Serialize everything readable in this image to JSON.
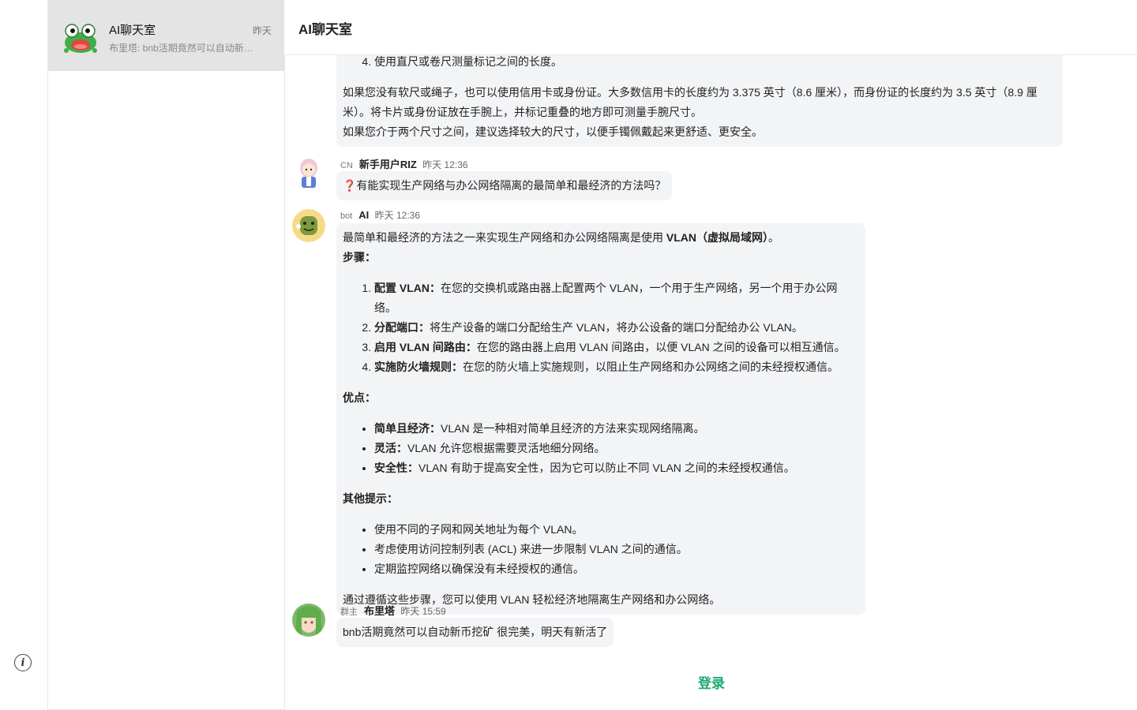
{
  "sidebar": {
    "conversation": {
      "name": "AI聊天室",
      "time": "昨天",
      "preview": "布里塔: bnb活期竟然可以自动新币挖矿 很完美，明天有新活了"
    }
  },
  "header": {
    "title": "AI聊天室"
  },
  "messages": {
    "m1": {
      "step4": "使用直尺或卷尺测量标记之间的长度。",
      "para1": "如果您没有软尺或绳子，也可以使用信用卡或身份证。大多数信用卡的长度约为 3.375 英寸（8.6 厘米），而身份证的长度约为 3.5 英寸（8.9 厘米）。将卡片或身份证放在手腕上，并标记重叠的地方即可测量手腕尺寸。",
      "para2": "如果您介于两个尺寸之间，建议选择较大的尺寸，以便手镯佩戴起来更舒适、更安全。"
    },
    "m2": {
      "role": "CN",
      "name": "新手用户RIZ",
      "time": "昨天 12:36",
      "text": "❓有能实现生产网络与办公网络隔离的最简单和最经济的方法吗？"
    },
    "m3": {
      "role": "bot",
      "name": "AI",
      "time": "昨天 12:36",
      "intro": "最简单和最经济的方法之一来实现生产网络和办公网络隔离是使用 ",
      "intro_bold": "VLAN（虚拟局域网）",
      "intro_end": "。",
      "steps_heading": "步骤：",
      "steps": [
        {
          "b": "配置 VLAN：",
          "t": "在您的交换机或路由器上配置两个 VLAN，一个用于生产网络，另一个用于办公网络。"
        },
        {
          "b": "分配端口：",
          "t": "将生产设备的端口分配给生产 VLAN，将办公设备的端口分配给办公 VLAN。"
        },
        {
          "b": "启用 VLAN 间路由：",
          "t": "在您的路由器上启用 VLAN 间路由，以便 VLAN 之间的设备可以相互通信。"
        },
        {
          "b": "实施防火墙规则：",
          "t": "在您的防火墙上实施规则，以阻止生产网络和办公网络之间的未经授权通信。"
        }
      ],
      "pros_heading": "优点：",
      "pros": [
        {
          "b": "简单且经济：",
          "t": "VLAN 是一种相对简单且经济的方法来实现网络隔离。"
        },
        {
          "b": "灵活：",
          "t": "VLAN 允许您根据需要灵活地细分网络。"
        },
        {
          "b": "安全性：",
          "t": "VLAN 有助于提高安全性，因为它可以防止不同 VLAN 之间的未经授权通信。"
        }
      ],
      "tips_heading": "其他提示：",
      "tips": [
        "使用不同的子网和网关地址为每个 VLAN。",
        "考虑使用访问控制列表 (ACL) 来进一步限制 VLAN 之间的通信。",
        "定期监控网络以确保没有未经授权的通信。"
      ],
      "outro": "通过遵循这些步骤，您可以使用 VLAN 轻松经济地隔离生产网络和办公网络。"
    },
    "m4": {
      "role": "群主",
      "name": "布里塔",
      "time": "昨天 15:59",
      "text": "bnb活期竟然可以自动新币挖矿 很完美，明天有新活了"
    }
  },
  "footer": {
    "login_label": "登录"
  },
  "icons": {
    "info": "info-icon"
  }
}
